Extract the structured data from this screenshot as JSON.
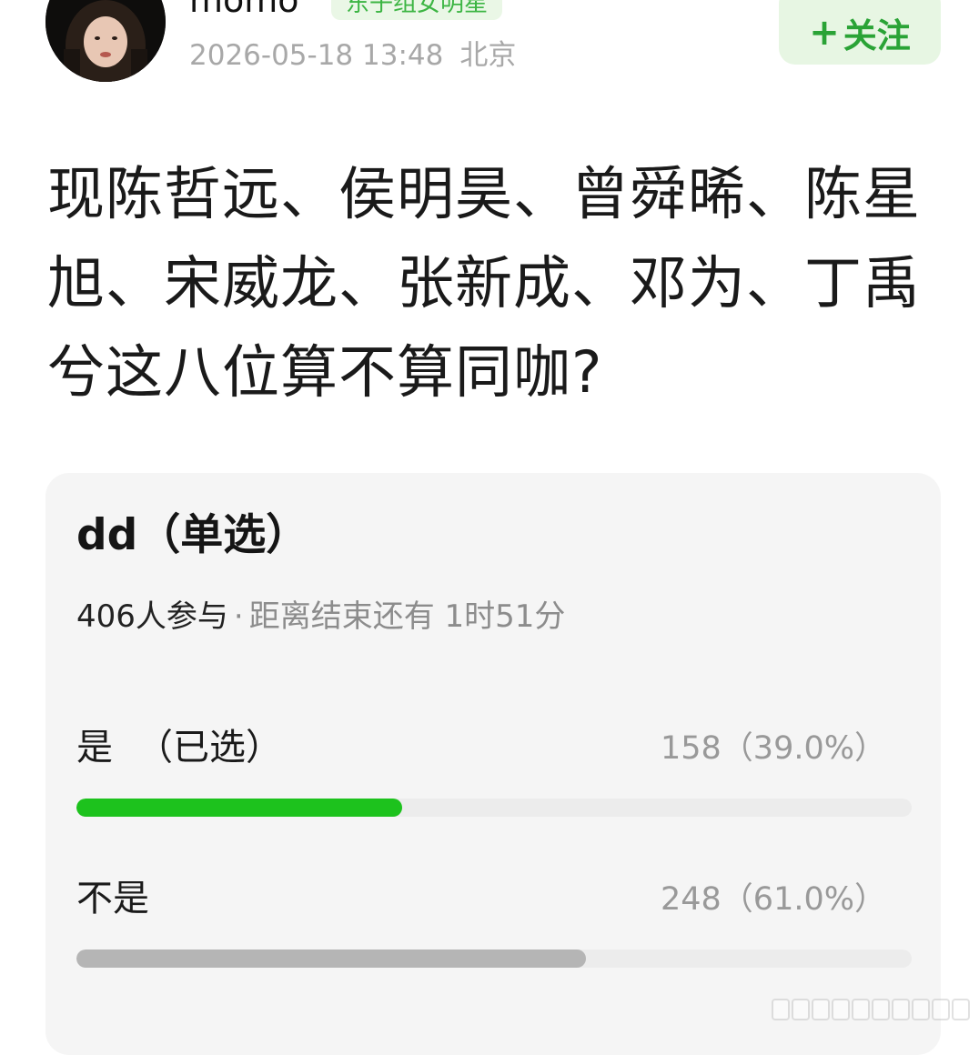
{
  "author": {
    "name": "momo",
    "tag": "东子组女明星",
    "date": "2026-05-18 13:48",
    "location": "北京"
  },
  "follow": {
    "plus": "+",
    "label": "关注"
  },
  "post": {
    "text": "现陈哲远、侯明昊、曾舜晞、陈星旭、宋威龙、张新成、邓为、丁禹兮这八位算不算同咖?"
  },
  "poll": {
    "title": "dd（单选）",
    "participants": "406人参与",
    "separator": "·",
    "remaining": "距离结束还有 1时51分",
    "options": [
      {
        "label": "是",
        "selected_tag": "（已选）",
        "result": "158（39.0%）",
        "fraction": 0.39,
        "color": "#1dc21d"
      },
      {
        "label": "不是",
        "selected_tag": "",
        "result": "248（61.0%）",
        "fraction": 0.61,
        "color": "#b5b5b5"
      }
    ]
  }
}
